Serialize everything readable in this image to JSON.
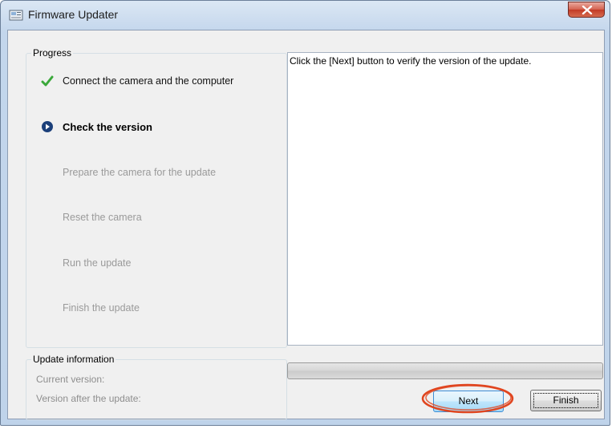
{
  "window": {
    "title": "Firmware Updater"
  },
  "progress": {
    "legend": "Progress",
    "steps": [
      {
        "label": "Connect the camera and the computer",
        "state": "done"
      },
      {
        "label": "Check the version",
        "state": "current"
      },
      {
        "label": "Prepare the camera for the update",
        "state": "pending"
      },
      {
        "label": "Reset the camera",
        "state": "pending"
      },
      {
        "label": "Run the update",
        "state": "pending"
      },
      {
        "label": "Finish the update",
        "state": "pending"
      }
    ]
  },
  "update_info": {
    "legend": "Update information",
    "current_version_label": "Current version:",
    "after_update_label": "Version after the update:"
  },
  "message": "Click the [Next] button to verify the version of the update.",
  "progress_bar": {
    "value": 0
  },
  "buttons": {
    "next": "Next",
    "finish": "Finish"
  },
  "colors": {
    "check": "#3aa83a",
    "current_marker": "#1b3f7a",
    "highlight": "#e0451f",
    "close": "#c23a25"
  }
}
